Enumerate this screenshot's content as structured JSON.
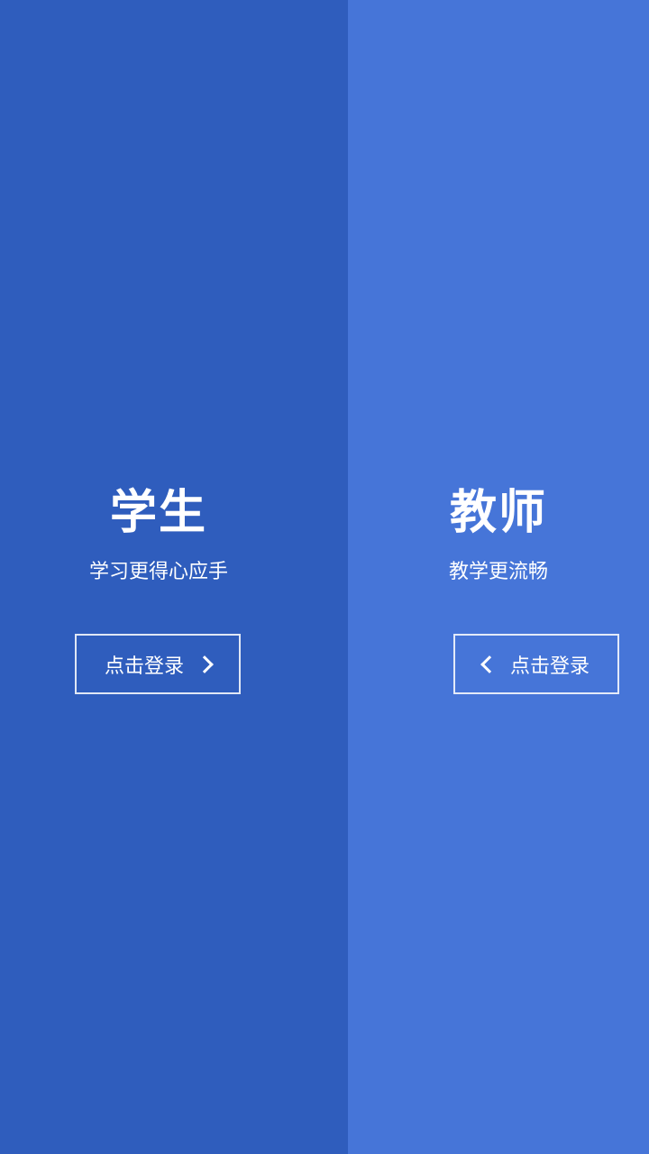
{
  "student": {
    "title": "学生",
    "subtitle": "学习更得心应手",
    "login_label": "点击登录",
    "icon": "chevron-right-icon"
  },
  "teacher": {
    "title": "教师",
    "subtitle": "教学更流畅",
    "login_label": "点击登录",
    "icon": "chevron-left-icon"
  },
  "colors": {
    "student_bg": "#2f5dbd",
    "teacher_bg": "#4675d8",
    "text": "#ffffff"
  }
}
